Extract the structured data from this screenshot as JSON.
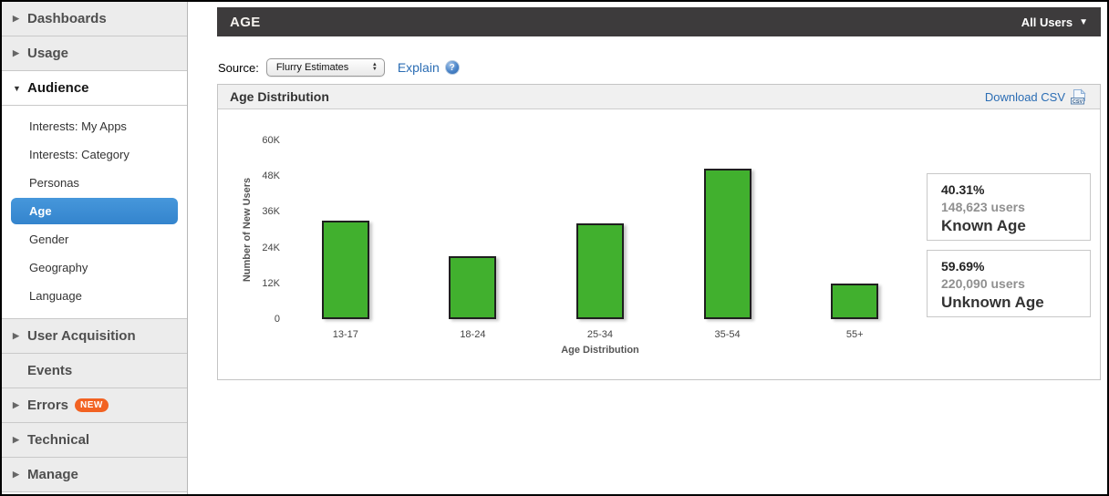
{
  "sidebar": {
    "sections": [
      {
        "label": "Dashboards"
      },
      {
        "label": "Usage"
      },
      {
        "label": "Audience"
      },
      {
        "label": "User Acquisition"
      },
      {
        "label": "Events"
      },
      {
        "label": "Errors",
        "badge": "NEW"
      },
      {
        "label": "Technical"
      },
      {
        "label": "Manage"
      }
    ],
    "audience_items": [
      {
        "label": "Interests: My Apps"
      },
      {
        "label": "Interests: Category"
      },
      {
        "label": "Personas"
      },
      {
        "label": "Age",
        "selected": true
      },
      {
        "label": "Gender"
      },
      {
        "label": "Geography"
      },
      {
        "label": "Language"
      }
    ]
  },
  "header": {
    "title": "AGE",
    "scope_label": "All Users"
  },
  "source_bar": {
    "label": "Source:",
    "selected_option": "Flurry Estimates",
    "explain_label": "Explain",
    "help_glyph": "?"
  },
  "panel": {
    "title": "Age Distribution",
    "download_label": "Download CSV"
  },
  "stats": [
    {
      "percent": "40.31%",
      "users": "148,623 users",
      "label": "Known Age"
    },
    {
      "percent": "59.69%",
      "users": "220,090 users",
      "label": "Unknown Age"
    }
  ],
  "chart_data": {
    "type": "bar",
    "title": "Age Distribution",
    "categories": [
      "13-17",
      "18-24",
      "25-34",
      "35-54",
      "55+"
    ],
    "values": [
      33000,
      21000,
      32000,
      50500,
      12000
    ],
    "xlabel": "Age Distribution",
    "ylabel": "Number of New Users",
    "ylim": [
      0,
      60000
    ],
    "yticks": [
      "60K",
      "48K",
      "36K",
      "24K",
      "12K",
      "0"
    ],
    "bar_color": "#41b02e",
    "bar_border_color": "#1f1f1f",
    "grid": false,
    "legend": false
  },
  "colors": {
    "accent_blue": "#3a8ad2",
    "link_blue": "#2b6db4",
    "bar_green": "#41b02e",
    "header_dark": "#3d3b3c",
    "badge_orange": "#f26222"
  }
}
